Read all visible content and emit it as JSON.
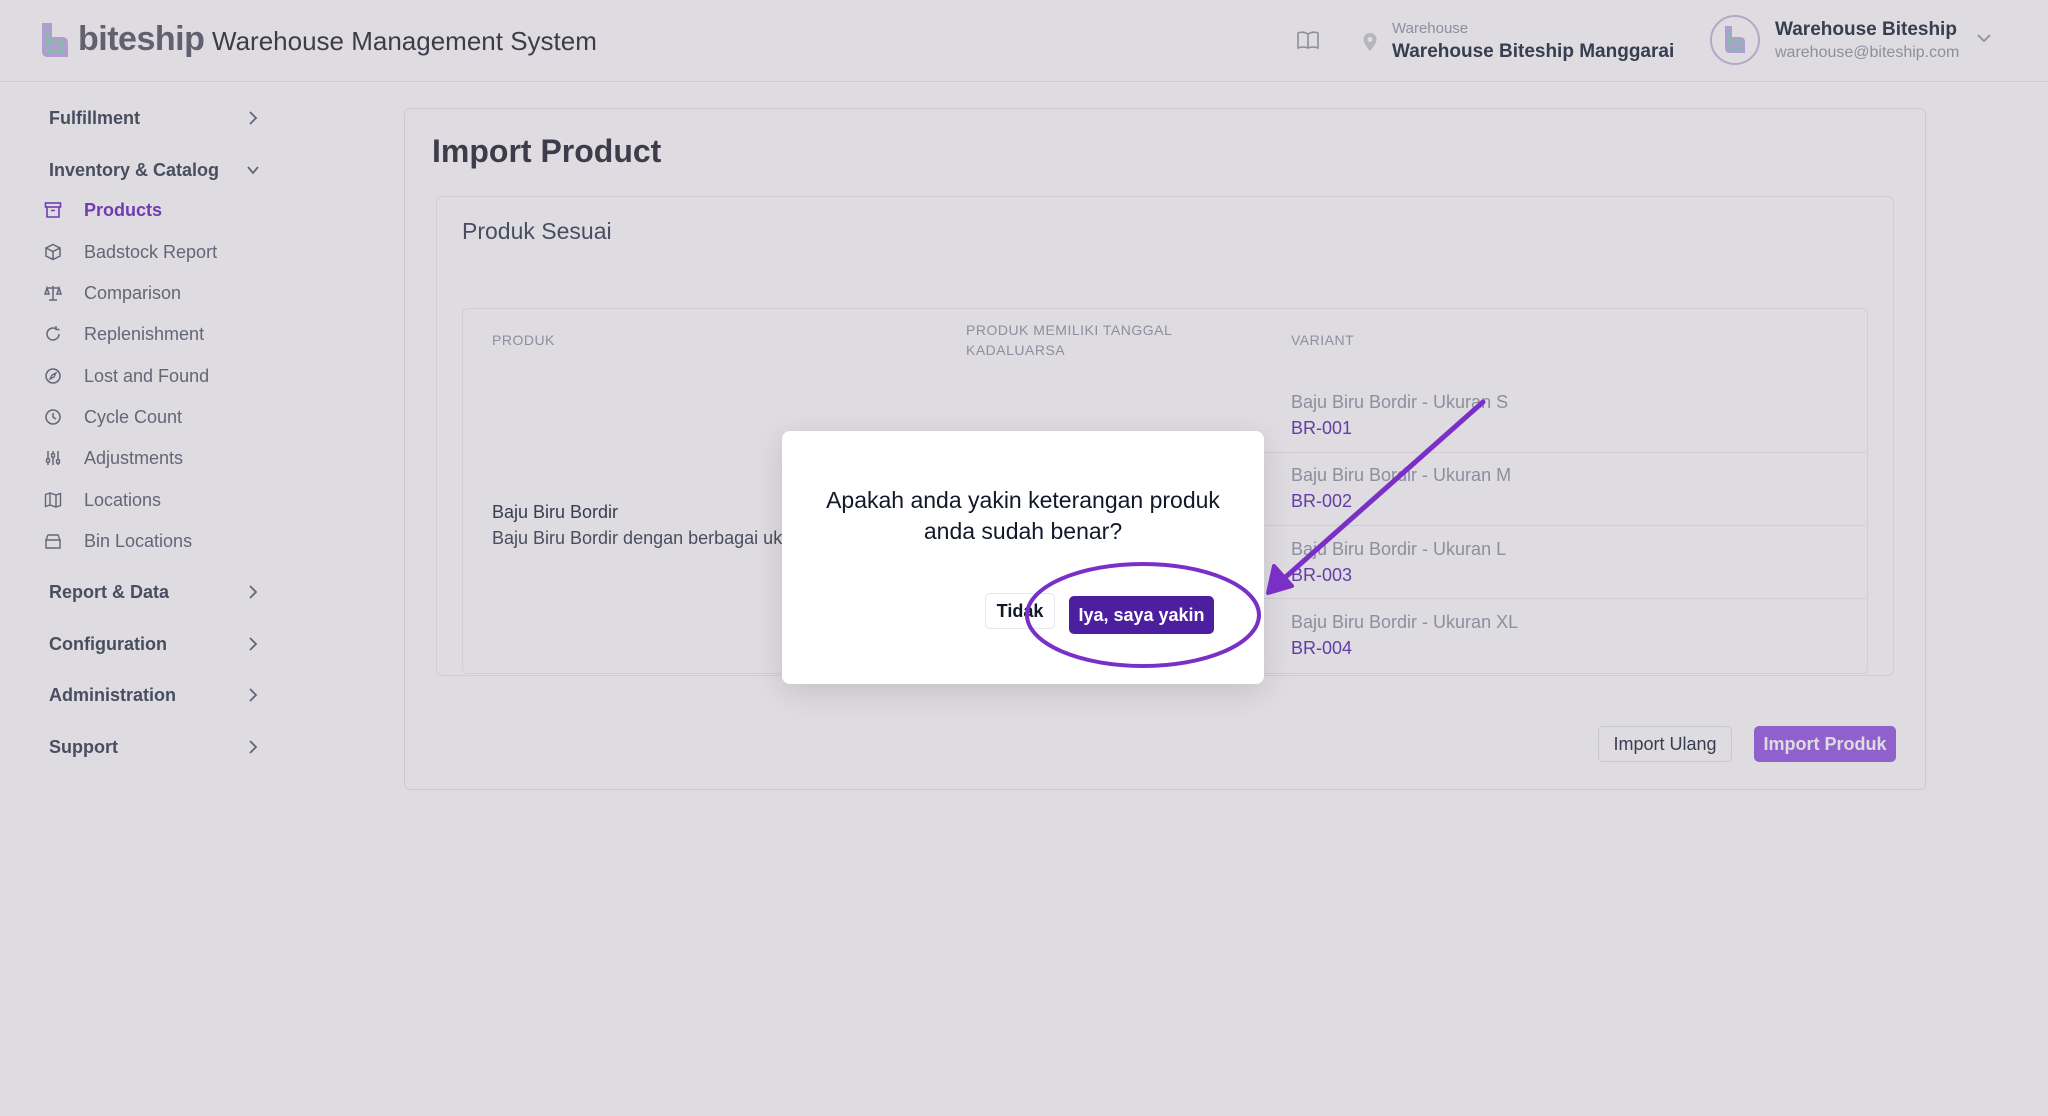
{
  "header": {
    "brand": "biteship",
    "app_title": "Warehouse Management System",
    "warehouse_label": "Warehouse",
    "warehouse_name": "Warehouse Biteship Manggarai",
    "user_name": "Warehouse Biteship",
    "user_email": "warehouse@biteship.com"
  },
  "sidebar": {
    "groups": {
      "fulfillment": "Fulfillment",
      "inventory": "Inventory & Catalog",
      "report": "Report & Data",
      "configuration": "Configuration",
      "administration": "Administration",
      "support": "Support"
    },
    "items": [
      {
        "label": "Products",
        "icon": "box-icon"
      },
      {
        "label": "Badstock Report",
        "icon": "cube-icon"
      },
      {
        "label": "Comparison",
        "icon": "scale-icon"
      },
      {
        "label": "Replenishment",
        "icon": "cycle-icon"
      },
      {
        "label": "Lost and Found",
        "icon": "compass-icon"
      },
      {
        "label": "Cycle Count",
        "icon": "clock-icon"
      },
      {
        "label": "Adjustments",
        "icon": "sliders-icon"
      },
      {
        "label": "Locations",
        "icon": "map-icon"
      },
      {
        "label": "Bin Locations",
        "icon": "bin-icon"
      }
    ]
  },
  "main": {
    "page_title": "Import Product",
    "section_title": "Produk Sesuai",
    "columns": {
      "produk": "PRODUK",
      "expiry_line1": "PRODUK MEMILIKI TANGGAL",
      "expiry_line2": "KADALUARSA",
      "variant": "VARIANT"
    },
    "product": {
      "name": "Baju Biru Bordir",
      "description": "Baju Biru Bordir dengan berbagai uk"
    },
    "variants": [
      {
        "name": "Baju Biru Bordir - Ukuran S",
        "sku": "BR-001"
      },
      {
        "name": "Baju Biru Bordir - Ukuran M",
        "sku": "BR-002"
      },
      {
        "name": "Baju Biru Bordir - Ukuran L",
        "sku": "BR-003"
      },
      {
        "name": "Baju Biru Bordir - Ukuran XL",
        "sku": "BR-004"
      }
    ],
    "reimport_label": "Import Ulang",
    "import_label": "Import Produk"
  },
  "modal": {
    "message": "Apakah anda yakin keterangan produk anda sudah benar?",
    "no_label": "Tidak",
    "yes_label": "Iya, saya yakin"
  },
  "colors": {
    "accent": "#7b3fc4",
    "primary_button": "#4b1f9e",
    "annotation": "#7a2fc7"
  }
}
